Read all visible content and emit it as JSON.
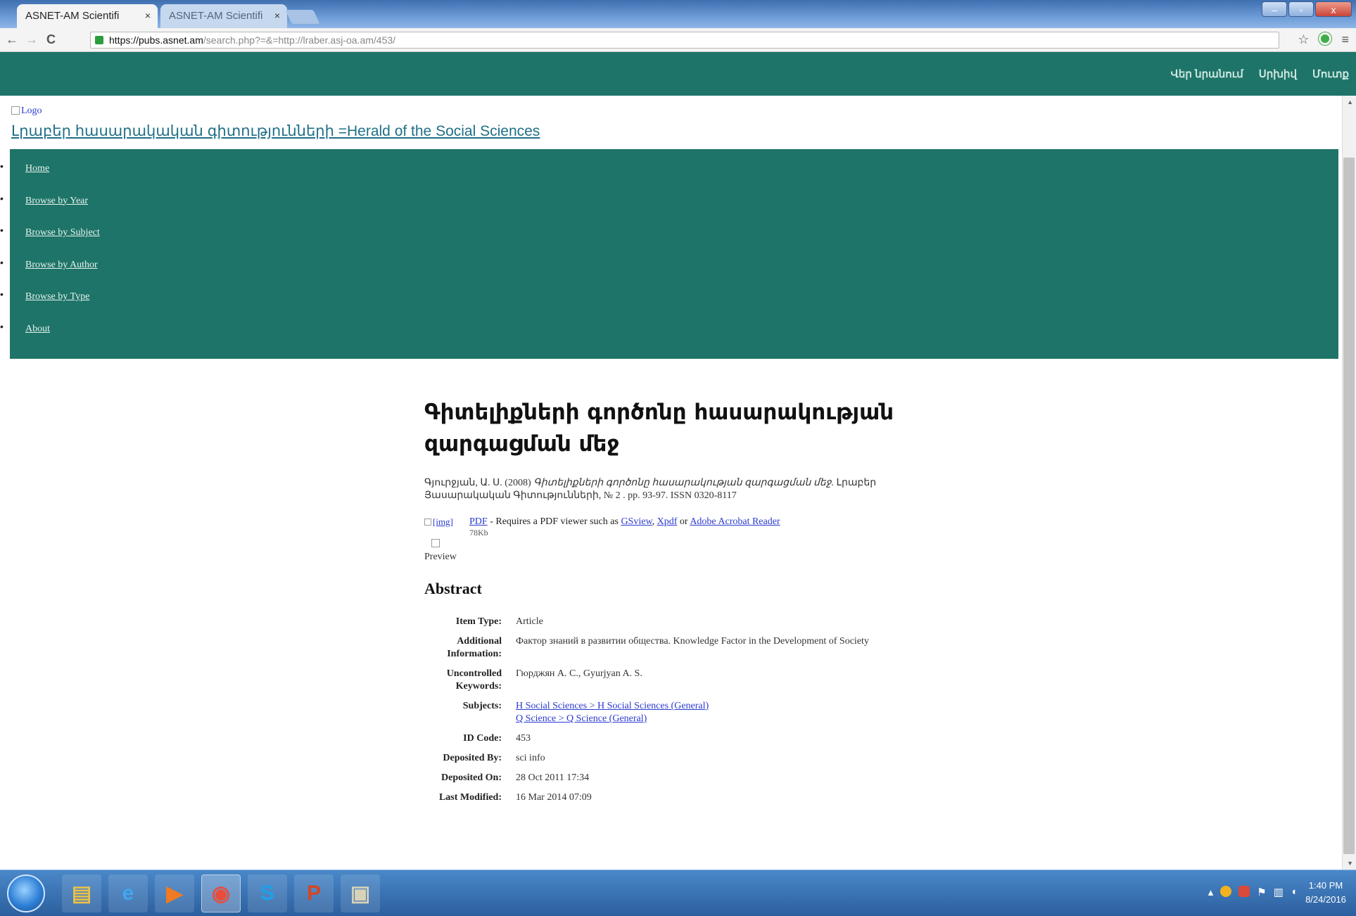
{
  "browser": {
    "tabs": [
      {
        "title": "ASNET-AM Scientifi",
        "close": "×"
      },
      {
        "title": "ASNET-AM Scientifi",
        "close": "×"
      }
    ],
    "window_controls": {
      "minimize": "–",
      "maximize": "▫",
      "close": "x"
    },
    "url_host": "https://pubs.asnet.am",
    "url_rest": "/search.php?=&=http://lraber.asj-oa.am/453/",
    "back": "←",
    "forward": "→",
    "reload": "C",
    "star": "☆",
    "menu": "≡"
  },
  "topbar": {
    "links": [
      "Վեր նրանում",
      "Սրխիվ",
      "Մուտք"
    ]
  },
  "header": {
    "logo_alt": "Logo",
    "site_title": "Լրաբեր հասարակական գիտությունների =Herald of the Social Sciences"
  },
  "nav": {
    "items": [
      "Home",
      "Browse by Year",
      "Browse by Subject",
      "Browse by Author",
      "Browse by Type",
      "About"
    ]
  },
  "eprint": {
    "title": "Գիտելիքների գործոնը հասարակության զարգացման մեջ",
    "citation_authors": "Գյուրջյան, Ա. Ս. (2008)",
    "citation_title": "Գիտելիքների գործոնը հասարակության զարգացման մեջ.",
    "citation_rest": "Լրաբեր Յասարակական Գիտությունների, № 2 . pp. 93-97. ISSN 0320-8117",
    "doc_img_alt": "[img]",
    "doc_format": "PDF",
    "doc_text_before": " - Requires a PDF viewer such as ",
    "doc_viewer_1": "GSview",
    "doc_text_sep": ", ",
    "doc_viewer_2": "Xpdf",
    "doc_text_or": " or ",
    "doc_viewer_3": "Adobe Acrobat Reader",
    "doc_size": "78Kb",
    "preview_label": "Preview",
    "abstract_heading": "Abstract"
  },
  "metadata": [
    {
      "label": "Item Type:",
      "value": "Article"
    },
    {
      "label": "Additional Information:",
      "value": "Фактор знаний в развитии общества. Knowledge Factor in the Development of Society"
    },
    {
      "label": "Uncontrolled Keywords:",
      "value": "Гюрджян А. С., Gyurjyan A. S."
    },
    {
      "label": "Subjects:",
      "links": [
        "H Social Sciences > H Social Sciences (General)",
        "Q Science > Q Science (General)"
      ]
    },
    {
      "label": "ID Code:",
      "value": "453"
    },
    {
      "label": "Deposited By:",
      "value": "sci info"
    },
    {
      "label": "Deposited On:",
      "value": "28 Oct 2011 17:34"
    },
    {
      "label": "Last Modified:",
      "value": "16 Mar 2014 07:09"
    }
  ],
  "taskbar": {
    "apps": [
      {
        "name": "explorer",
        "glyph": "▤",
        "color": "#e8c14a"
      },
      {
        "name": "ie",
        "glyph": "e",
        "color": "#3fa7f0"
      },
      {
        "name": "media",
        "glyph": "▶",
        "color": "#f07a22"
      },
      {
        "name": "chrome",
        "glyph": "◉",
        "color": "#e84d3c"
      },
      {
        "name": "skype",
        "glyph": "S",
        "color": "#1ea0e8"
      },
      {
        "name": "powerpoint",
        "glyph": "P",
        "color": "#d24726"
      },
      {
        "name": "app",
        "glyph": "▣",
        "color": "#d7d2b8"
      }
    ],
    "clock_time": "1:40 PM",
    "clock_date": "8/24/2016"
  },
  "colors": {
    "teal": "#1e7468",
    "link": "#2a3ad0",
    "site_title": "#1f6f86"
  }
}
